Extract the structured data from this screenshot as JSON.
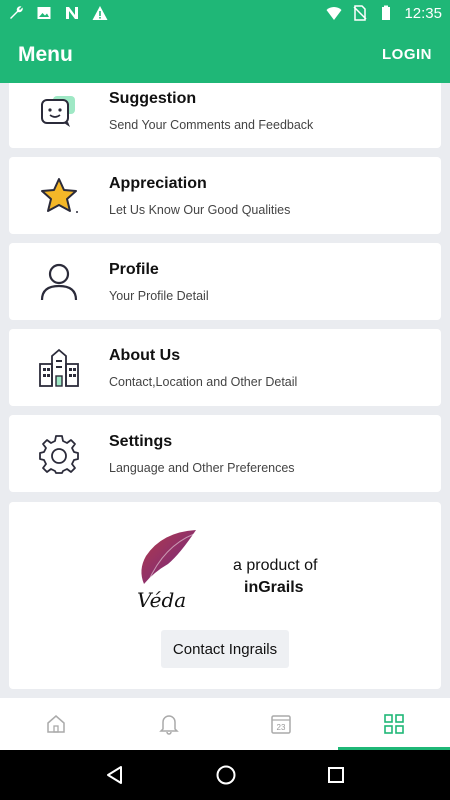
{
  "status_bar": {
    "time": "12:35",
    "icons": [
      "wrench-icon",
      "image-icon",
      "n-icon",
      "warning-icon",
      "wifi-icon",
      "no-sim-icon",
      "battery-icon"
    ]
  },
  "app_bar": {
    "title": "Menu",
    "login_label": "LOGIN"
  },
  "menu_items": [
    {
      "title": "Suggestion",
      "subtitle": "Send Your Comments and Feedback",
      "icon": "chat-bubble-icon"
    },
    {
      "title": "Appreciation",
      "subtitle": "Let Us Know Our Good Qualities",
      "icon": "star-icon"
    },
    {
      "title": "Profile",
      "subtitle": "Your Profile Detail",
      "icon": "user-icon"
    },
    {
      "title": "About Us",
      "subtitle": "Contact,Location and Other Detail",
      "icon": "building-icon"
    },
    {
      "title": "Settings",
      "subtitle": "Language and Other Preferences",
      "icon": "gear-icon"
    }
  ],
  "promo": {
    "logo_text": "Véda",
    "tagline": "a product of",
    "brand": "inGrails",
    "contact_label": "Contact Ingrails"
  },
  "bottom_nav": {
    "tabs": [
      {
        "icon": "home-icon",
        "active": false
      },
      {
        "icon": "bell-icon",
        "active": false
      },
      {
        "icon": "calendar-icon",
        "label": "23",
        "active": false
      },
      {
        "icon": "grid-icon",
        "active": true
      }
    ]
  },
  "colors": {
    "primary": "#1fb777",
    "accent_yellow": "#f4b728"
  }
}
